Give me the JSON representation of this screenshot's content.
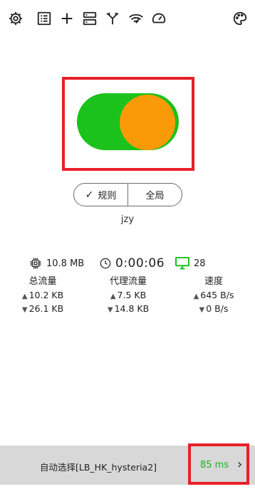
{
  "toolbar": {
    "icons": [
      "gear-icon",
      "list-icon",
      "plus-icon",
      "server-icon",
      "fork-icon",
      "wifi-speed-icon",
      "speedometer-icon",
      "palette-icon"
    ]
  },
  "toggle": {
    "state": "on",
    "track_color": "#1bc21b",
    "knob_color": "#fb9a09"
  },
  "mode_switch": {
    "options": [
      {
        "label": "规则",
        "selected": true
      },
      {
        "label": "全局",
        "selected": false
      }
    ]
  },
  "profile": {
    "name": "jzy"
  },
  "stats": {
    "memory": "10.8 MB",
    "uptime": "0:00:06",
    "connections": "28",
    "columns": [
      {
        "title": "总流量",
        "up": "10.2 KB",
        "down": "26.1 KB"
      },
      {
        "title": "代理流量",
        "up": "7.5 KB",
        "down": "14.8 KB"
      },
      {
        "title": "速度",
        "up": "645 B/s",
        "down": "0 B/s"
      }
    ]
  },
  "bottom": {
    "proxy": "自动选择[LB_HK_hysteria2]",
    "latency": "85 ms",
    "latency_color": "#1bb31b"
  },
  "colors": {
    "highlight_frame": "#e8202a",
    "accent_green": "#1bc21b"
  }
}
